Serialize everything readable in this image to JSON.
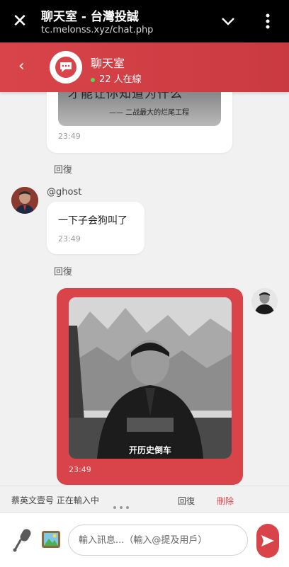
{
  "browser": {
    "title": "聊天室 - 台灣投誠",
    "url": "tc.melonss.xyz/chat.php"
  },
  "header": {
    "title": "聊天室",
    "online": "22 人在線"
  },
  "messages": [
    {
      "image_text": "才能让你知道为什么",
      "image_quote": "—— 二战最大的烂尾工程",
      "time": "23:49",
      "reply": "回復"
    },
    {
      "username": "@ghost",
      "text": "一下子会狗叫了",
      "time": "23:49",
      "reply": "回復"
    },
    {
      "image_caption": "开历史倒车",
      "time": "23:49"
    }
  ],
  "typing": {
    "text": "蔡英文壹号 正在輸入中",
    "reply": "回復",
    "delete": "刪除"
  },
  "composer": {
    "placeholder": "輸入訊息...（輸入@提及用戶）"
  },
  "colors": {
    "accent": "#d8444a",
    "online_dot": "#5fd35f",
    "browser_bar": "#000000"
  }
}
